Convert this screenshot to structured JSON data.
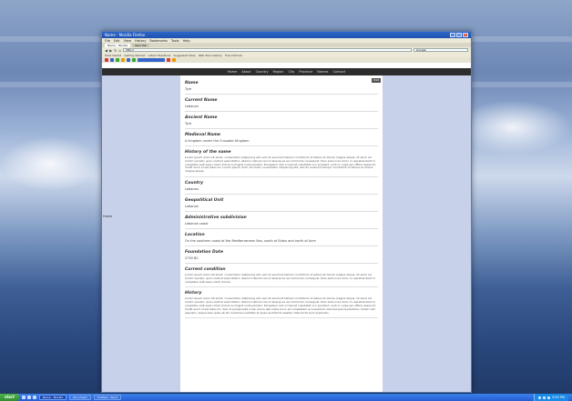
{
  "browser": {
    "window_title": "Name - Mozilla Firefox",
    "menu": [
      "File",
      "Edit",
      "View",
      "History",
      "Bookmarks",
      "Tools",
      "Help"
    ],
    "tabs": [
      "Name - Mozilla",
      "New Tab"
    ],
    "url": "http://",
    "search_placeholder": "Google",
    "bookmarks": [
      "Most Visited",
      "Getting Started",
      "Latest Headlines",
      "Suggested Sites",
      "Web Slice Gallery",
      "Free Hotmail"
    ]
  },
  "site": {
    "nav": [
      "Home",
      "About",
      "Country",
      "Region",
      "City",
      "Province",
      "Names",
      "Contact"
    ],
    "edit_label": "Edit",
    "left_label": "Home"
  },
  "fields": [
    {
      "label": "Name",
      "value": "Tyre"
    },
    {
      "label": "Current Name",
      "value": "Lebanon"
    },
    {
      "label": "Ancient Name",
      "value": "Tyre"
    },
    {
      "label": "Medieval Name",
      "value": "A kingdom under the Crusader Kingdom"
    },
    {
      "label": "History of the name",
      "value": "Lorem ipsum dolor sit amet, consectetur adipiscing elit, sed do eiusmod tempor incididunt ut labore et dolore magna aliqua. Ut enim ad minim veniam, quis nostrud exercitation ullamco laboris nisi ut aliquip ex ea commodo consequat. Duis aute irure dolor in reprehenderit in voluptate velit esse cillum dolore eu fugiat nulla pariatur. Excepteur sint occaecat cupidatat non proident, sunt in culpa qui officia deserunt mollit anim id est laborum. Lorem ipsum dolor sit amet, consectetur adipiscing elit, sed do eiusmod tempor incididunt ut labore et dolore magna aliqua.",
      "long": true
    },
    {
      "label": "Country",
      "value": "Lebanon"
    },
    {
      "label": "Geopolitical Unit",
      "value": "Lebanon"
    },
    {
      "label": "Administrative subdivision",
      "value": "Lebanon coast"
    },
    {
      "label": "Location",
      "value": "On the southern coast of the Mediterranean Sea, south of Sidon and north of Acre"
    },
    {
      "label": "Foundation Date",
      "value": "2750 BC"
    },
    {
      "label": "Current condition",
      "value": "Lorem ipsum dolor sit amet, consectetur adipiscing elit, sed do eiusmod tempor incididunt ut labore et dolore magna aliqua. Ut enim ad minim veniam, quis nostrud exercitation ullamco laboris nisi ut aliquip ex ea commodo consequat. Duis aute irure dolor in reprehenderit in voluptate velit esse cillum dolore.",
      "long": true
    },
    {
      "label": "History",
      "value": "Lorem ipsum dolor sit amet, consectetur adipiscing elit, sed do eiusmod tempor incididunt ut labore et dolore magna aliqua. Ut enim ad minim veniam, quis nostrud exercitation ullamco laboris nisi ut aliquip ex ea commodo consequat. Duis aute irure dolor in reprehenderit in voluptate velit esse cillum dolore eu fugiat nulla pariatur. Excepteur sint occaecat cupidatat non proident, sunt in culpa qui officia deserunt mollit anim id est laborum. Sed ut perspiciatis unde omnis iste natus error sit voluptatem accusantium doloremque laudantium, totam rem aperiam, eaque ipsa quae ab illo inventore veritatis et quasi architecto beatae vitae dicta sunt explicabo.",
      "long": true
    }
  ],
  "taskbar": {
    "start_label": "start",
    "tasks": [
      "Name - Mozilla",
      "Document",
      "Untitled - Paint"
    ],
    "clock": "3:09 PM"
  },
  "colors": {
    "accent": "#245ed6",
    "start": "#2f8c2f",
    "page_bg": "#c8d1ea",
    "site_nav": "#2d2d2d"
  }
}
